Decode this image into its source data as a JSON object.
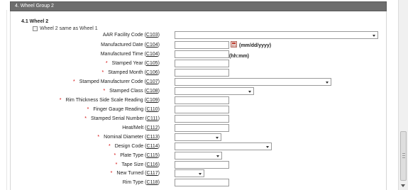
{
  "section": {
    "title": "4. Wheel Group 2"
  },
  "subsection": {
    "title": "4.1 Wheel 2"
  },
  "same_as": {
    "label": "Wheel 2 same as Wheel 1",
    "checked": false
  },
  "hints": {
    "date": "(mm/dd/yyyy)",
    "time": "(hh:mm)"
  },
  "fields": [
    {
      "label": "AAR Facility Code (",
      "code": "C103",
      "close": ")",
      "required": false,
      "type": "select",
      "value": ""
    },
    {
      "label": "Manufactured Date (",
      "code": "C104",
      "close": ")",
      "required": false,
      "type": "date",
      "value": ""
    },
    {
      "label": "Manufactured Time (",
      "code": "C104",
      "close": ")",
      "required": false,
      "type": "time",
      "value": ""
    },
    {
      "label": "Stamped Year (",
      "code": "C105",
      "close": ")",
      "required": true,
      "type": "text",
      "value": ""
    },
    {
      "label": "Stamped Month (",
      "code": "C106",
      "close": ")",
      "required": true,
      "type": "text",
      "value": ""
    },
    {
      "label": "Stamped Manufacturer Code (",
      "code": "C107",
      "close": ")",
      "required": true,
      "type": "select",
      "value": ""
    },
    {
      "label": "Stamped Class (",
      "code": "C108",
      "close": ")",
      "required": true,
      "type": "select",
      "value": ""
    },
    {
      "label": "Rim Thickness Side Scale Reading (",
      "code": "C109",
      "close": ")",
      "required": true,
      "type": "text",
      "value": ""
    },
    {
      "label": "Finger Gauge Reading (",
      "code": "C110",
      "close": ")",
      "required": true,
      "type": "text",
      "value": ""
    },
    {
      "label": "Stamped Serial Number (",
      "code": "C111",
      "close": ")",
      "required": true,
      "type": "text",
      "value": ""
    },
    {
      "label": "Heat/Melt (",
      "code": "C112",
      "close": ")",
      "required": false,
      "type": "text",
      "value": ""
    },
    {
      "label": "Nominal Diameter (",
      "code": "C113",
      "close": ")",
      "required": true,
      "type": "select",
      "value": ""
    },
    {
      "label": "Design Code (",
      "code": "C114",
      "close": ")",
      "required": true,
      "type": "select",
      "value": ""
    },
    {
      "label": "Plate Type (",
      "code": "C115",
      "close": ")",
      "required": true,
      "type": "select",
      "value": ""
    },
    {
      "label": "Tape Size (",
      "code": "C116",
      "close": ")",
      "required": true,
      "type": "text",
      "value": ""
    },
    {
      "label": "New Turned (",
      "code": "C117",
      "close": ")",
      "required": true,
      "type": "select",
      "value": ""
    },
    {
      "label": "Rim Type (",
      "code": "C118",
      "close": ")",
      "required": false,
      "type": "text",
      "value": ""
    }
  ]
}
